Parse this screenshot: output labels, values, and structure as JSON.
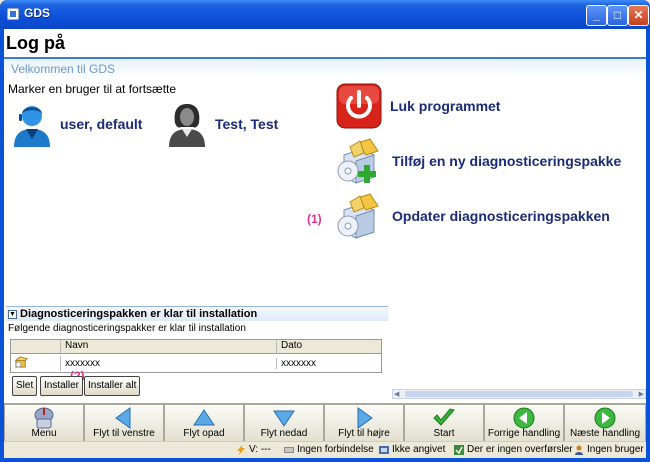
{
  "window": {
    "title": "GDS",
    "minimize_glyph": "_",
    "maximize_glyph": "□",
    "close_glyph": "✕"
  },
  "page": {
    "title": "Log på",
    "welcome": "Velkommen til GDS",
    "instruction": "Marker en bruger til at fortsætte"
  },
  "users": [
    {
      "label": "user, default",
      "icon": "male-user-icon"
    },
    {
      "label": "Test, Test",
      "icon": "female-user-icon"
    }
  ],
  "actions": {
    "quit": "Luk programmet",
    "add_package": "Tilføj en ny diagnosticeringspakke",
    "update_package": "Opdater diagnosticeringspakken",
    "marker_1": "(1)"
  },
  "install_panel": {
    "title": "Diagnosticeringspakken er klar til installation",
    "subtitle": "Følgende diagnosticeringspakker er klar til installation",
    "columns": {
      "name": "Navn",
      "date": "Dato"
    },
    "rows": [
      {
        "name": "xxxxxxx",
        "date": "xxxxxxx"
      }
    ],
    "buttons": {
      "delete": "Slet",
      "install": "Installer",
      "install_all": "Installer alt"
    },
    "marker_2": "(2)"
  },
  "toolbar": [
    {
      "label": "Menu",
      "icon": "menu-icon"
    },
    {
      "label": "Flyt til venstre",
      "icon": "arrow-left-icon"
    },
    {
      "label": "Flyt opad",
      "icon": "arrow-up-icon"
    },
    {
      "label": "Flyt nedad",
      "icon": "arrow-down-icon"
    },
    {
      "label": "Flyt til højre",
      "icon": "arrow-right-icon"
    },
    {
      "label": "Start",
      "icon": "checkmark-icon"
    },
    {
      "label": "Forrige handling",
      "icon": "back-icon"
    },
    {
      "label": "Næste handling",
      "icon": "forward-icon"
    }
  ],
  "status": {
    "version": "V: ---",
    "connection": "Ingen forbindelse",
    "specified": "Ikke angivet",
    "transfers": "Der er ingen overførsler",
    "user": "Ingen bruger"
  },
  "colors": {
    "accent": "#1b2a7a",
    "marker": "#e0328f",
    "titlebar": "#0d4fd8"
  }
}
